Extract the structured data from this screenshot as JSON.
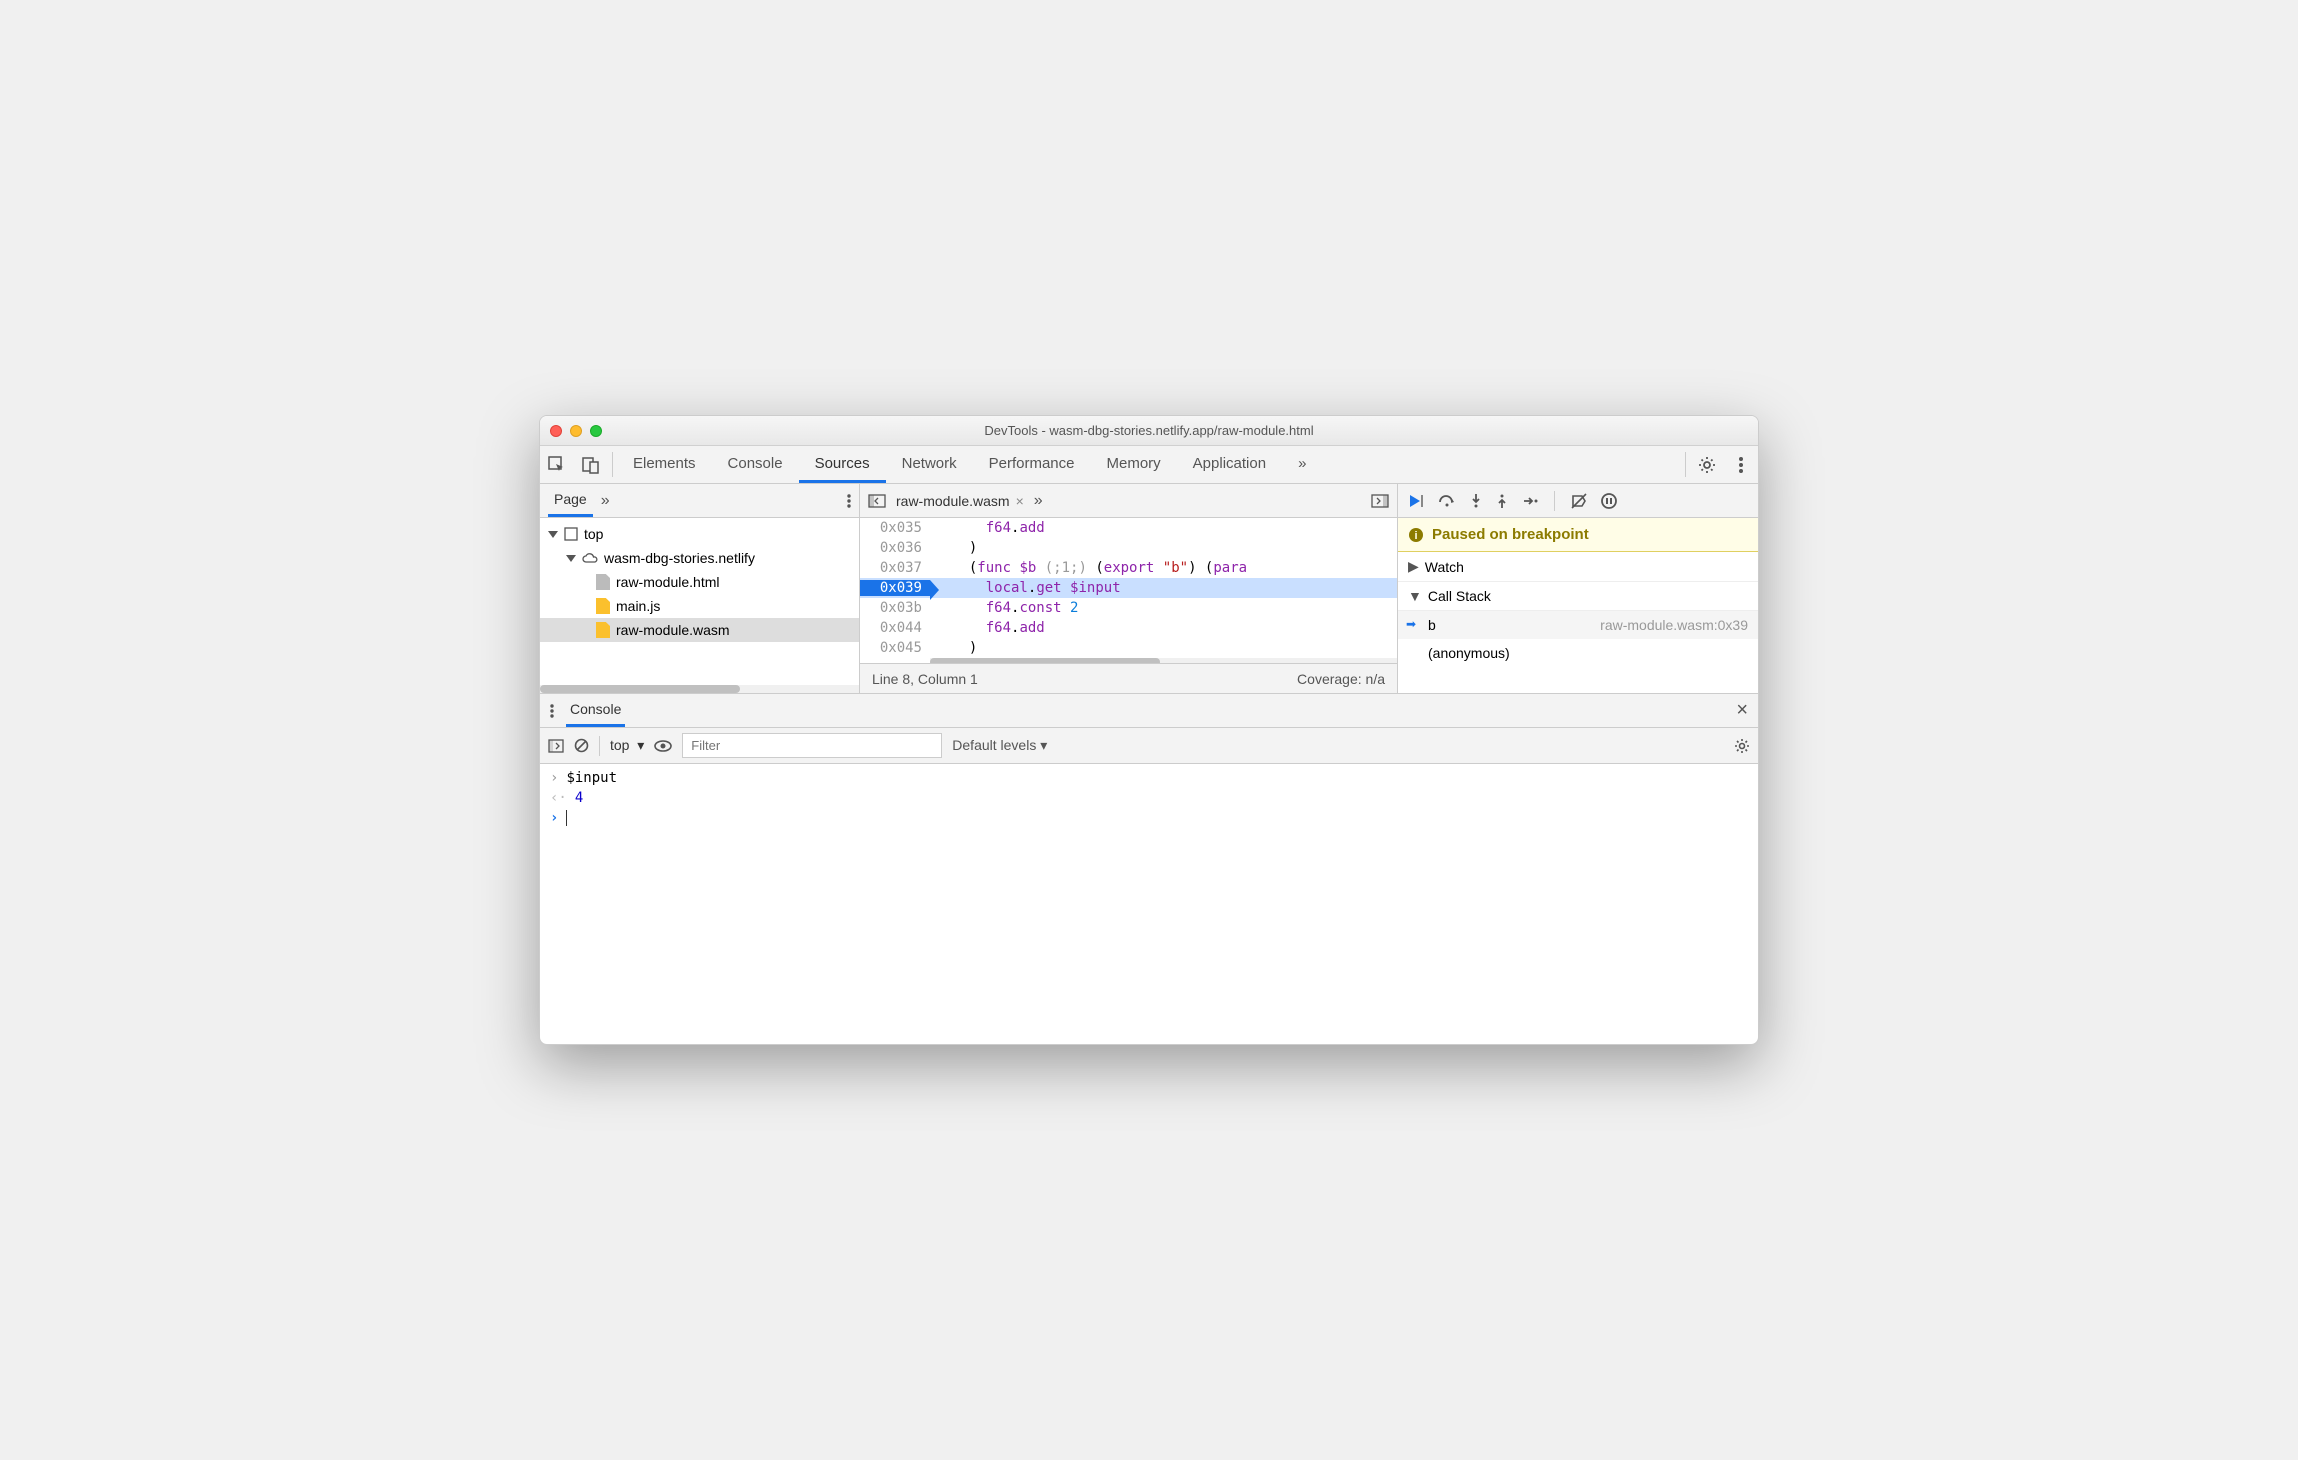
{
  "window": {
    "title": "DevTools - wasm-dbg-stories.netlify.app/raw-module.html"
  },
  "tabs": [
    "Elements",
    "Console",
    "Sources",
    "Network",
    "Performance",
    "Memory",
    "Application"
  ],
  "activeTab": "Sources",
  "navigator": {
    "tab": "Page",
    "tree": {
      "top": "top",
      "domain": "wasm-dbg-stories.netlify",
      "files": [
        "raw-module.html",
        "main.js",
        "raw-module.wasm"
      ],
      "selected": "raw-module.wasm"
    }
  },
  "source": {
    "filename": "raw-module.wasm",
    "lines": [
      {
        "addr": "0x035",
        "text": "    f64.add",
        "hl": false,
        "bp": false
      },
      {
        "addr": "0x036",
        "text": "  )",
        "hl": false,
        "bp": false
      },
      {
        "addr": "0x037",
        "text": "  (func $b (;1;) (export \"b\") (param",
        "hl": false,
        "bp": false
      },
      {
        "addr": "0x039",
        "text": "    local.get $input",
        "hl": true,
        "bp": true
      },
      {
        "addr": "0x03b",
        "text": "    f64.const 2",
        "hl": false,
        "bp": false
      },
      {
        "addr": "0x044",
        "text": "    f64.add",
        "hl": false,
        "bp": false
      },
      {
        "addr": "0x045",
        "text": "  )",
        "hl": false,
        "bp": false
      }
    ],
    "status_line": "Line 8, Column 1",
    "status_cov": "Coverage: n/a"
  },
  "debugger": {
    "banner": "Paused on breakpoint",
    "watch": "Watch",
    "callstack": "Call Stack",
    "frames": [
      {
        "name": "b",
        "loc": "raw-module.wasm:0x39",
        "current": true
      },
      {
        "name": "(anonymous)",
        "loc": "",
        "current": false
      }
    ]
  },
  "drawer": {
    "tab": "Console"
  },
  "console_toolbar": {
    "context": "top",
    "filter_placeholder": "Filter",
    "levels": "Default levels ▾"
  },
  "console": {
    "input": "$input",
    "output": "4"
  }
}
